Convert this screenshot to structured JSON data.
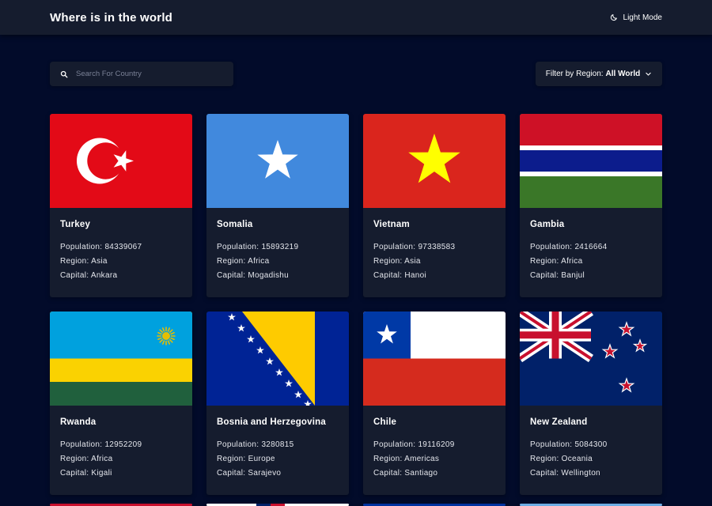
{
  "header": {
    "title": "Where is in the world",
    "theme_toggle_label": "Light Mode"
  },
  "search": {
    "placeholder": "Search For Country",
    "value": ""
  },
  "filter": {
    "label": "Filter by Region:",
    "value": "All World"
  },
  "labels": {
    "population": "Population:",
    "region": "Region:",
    "capital": "Capital:"
  },
  "countries": [
    {
      "name": "Turkey",
      "population": "84339067",
      "region": "Asia",
      "capital": "Ankara"
    },
    {
      "name": "Somalia",
      "population": "15893219",
      "region": "Africa",
      "capital": "Mogadishu"
    },
    {
      "name": "Vietnam",
      "population": "97338583",
      "region": "Asia",
      "capital": "Hanoi"
    },
    {
      "name": "Gambia",
      "population": "2416664",
      "region": "Africa",
      "capital": "Banjul"
    },
    {
      "name": "Rwanda",
      "population": "12952209",
      "region": "Africa",
      "capital": "Kigali"
    },
    {
      "name": "Bosnia and Herzegovina",
      "population": "3280815",
      "region": "Europe",
      "capital": "Sarajevo"
    },
    {
      "name": "Chile",
      "population": "19116209",
      "region": "Americas",
      "capital": "Santiago"
    },
    {
      "name": "New Zealand",
      "population": "5084300",
      "region": "Oceania",
      "capital": "Wellington"
    }
  ],
  "colors": {
    "background": "#020b2a",
    "surface": "#151c2e",
    "text": "#ffffff"
  },
  "icons": {
    "theme": "moon-icon",
    "search": "search-icon",
    "filter": "chevron-down-icon"
  }
}
